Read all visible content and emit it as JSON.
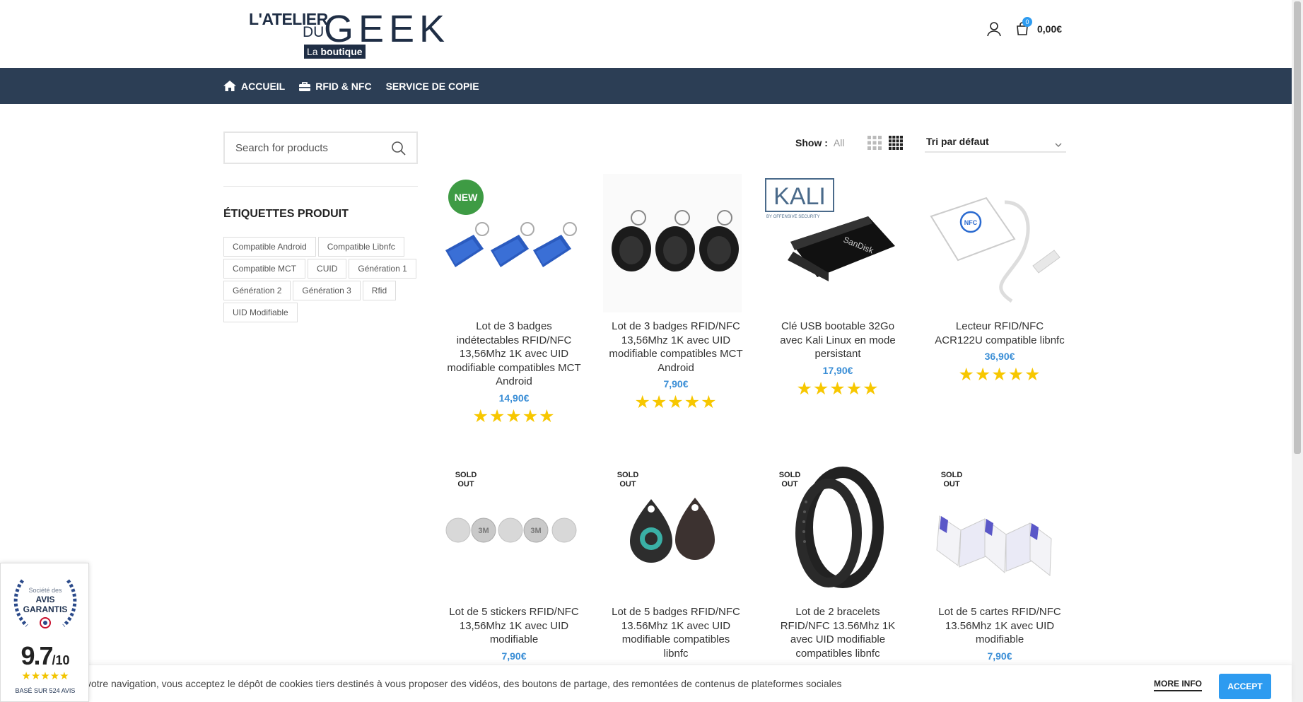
{
  "header": {
    "logo": {
      "line1": "L'ATELIER",
      "line2": "DU",
      "line3": "GEEK",
      "tag_pre": "La",
      "tag_bold": "boutique"
    },
    "cart_count": "0",
    "cart_total": "0,00€"
  },
  "nav": {
    "items": [
      {
        "label": "ACCUEIL",
        "icon": "home-icon"
      },
      {
        "label": "RFID & NFC",
        "icon": "bag-icon"
      },
      {
        "label": "SERVICE DE COPIE",
        "icon": ""
      }
    ]
  },
  "sidebar": {
    "search_placeholder": "Search for products",
    "tags_title": "ÉTIQUETTES PRODUIT",
    "tags": [
      "Compatible Android",
      "Compatible Libnfc",
      "Compatible MCT",
      "CUID",
      "Génération 1",
      "Génération 2",
      "Génération 3",
      "Rfid",
      "UID Modifiable"
    ]
  },
  "toolbar": {
    "show_label": "Show :",
    "show_value": "All",
    "sort_label": "Tri par défaut"
  },
  "products": [
    {
      "name": "Lot de 3 badges indétectables RFID/NFC 13,56Mhz 1K avec UID modifiable compatibles MCT Android",
      "price": "14,90€",
      "rating": 5,
      "badge": "NEW",
      "image": "blue-key-fobs"
    },
    {
      "name": "Lot de 3 badges RFID/NFC 13,56Mhz 1K avec UID modifiable compatibles MCT Android",
      "price": "7,90€",
      "rating": 5,
      "badge": "",
      "image": "black-key-fobs"
    },
    {
      "name": "Clé USB bootable 32Go avec Kali Linux en mode persistant",
      "price": "17,90€",
      "rating": 5,
      "badge": "",
      "image": "kali-usb",
      "image_text": "KALI",
      "image_subtext": "BY OFFENSIVE SECURITY",
      "image_brand": "SanDisk"
    },
    {
      "name": "Lecteur RFID/NFC ACR122U compatible libnfc",
      "price": "36,90€",
      "rating": 5,
      "badge": "",
      "image": "nfc-reader",
      "image_text": "NFC"
    },
    {
      "name": "Lot de 5 stickers RFID/NFC 13,56Mhz 1K avec UID modifiable",
      "price": "7,90€",
      "badge": "SOLD OUT",
      "image": "stickers",
      "image_text": "3M"
    },
    {
      "name": "Lot de 5 badges RFID/NFC 13.56Mhz 1K avec UID modifiable compatibles libnfc",
      "price": "",
      "badge": "SOLD OUT",
      "image": "teardrop-tags"
    },
    {
      "name": "Lot de 2 bracelets RFID/NFC 13.56Mhz 1K avec UID modifiable compatibles libnfc",
      "price": "",
      "badge": "SOLD OUT",
      "image": "bracelets"
    },
    {
      "name": "Lot de 5 cartes RFID/NFC 13.56Mhz 1K avec UID modifiable",
      "price": "7,90€",
      "badge": "SOLD OUT",
      "image": "cards"
    }
  ],
  "review_widget": {
    "line1": "Société des",
    "line2a": "AVIS",
    "line2b": "GARANTIS",
    "score": "9.7",
    "out_of": "/10",
    "base": "BASÉ SUR 524 AVIS"
  },
  "cookie": {
    "text": "votre navigation, vous acceptez le dépôt de cookies tiers destinés à vous proposer des vidéos, des boutons de partage, des remontées de contenus de plateformes sociales",
    "more_label": "MORE INFO",
    "accept_label": "ACCEPT"
  },
  "colors": {
    "nav_bg": "#2c3e55",
    "price": "#3a8ed6",
    "accent": "#2d9bf0",
    "new_badge": "#3e9b44",
    "stars": "#f7c700"
  }
}
